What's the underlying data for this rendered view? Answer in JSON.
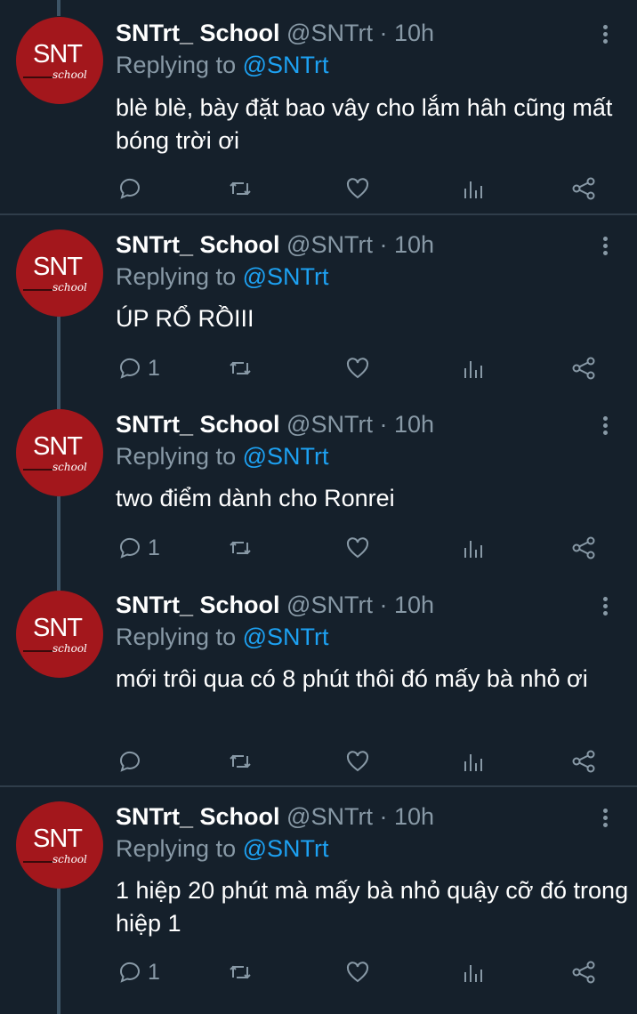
{
  "tweets": [
    {
      "name": "SNTrt_ School",
      "handle": "@SNTrt",
      "time": "· 10h",
      "replying": "Replying to",
      "mention": "@SNTrt",
      "text": "blè blè, bày đặt bao vây cho lắm hâh cũng mất bóng trời ơi",
      "reply_count": ""
    },
    {
      "name": "SNTrt_ School",
      "handle": "@SNTrt",
      "time": "· 10h",
      "replying": "Replying to",
      "mention": "@SNTrt",
      "text": "ÚP RỔ RỒIII",
      "reply_count": "1"
    },
    {
      "name": "SNTrt_ School",
      "handle": "@SNTrt",
      "time": "· 10h",
      "replying": "Replying to",
      "mention": "@SNTrt",
      "text": "two điểm dành cho Ronrei",
      "reply_count": "1"
    },
    {
      "name": "SNTrt_ School",
      "handle": "@SNTrt",
      "time": "· 10h",
      "replying": "Replying to",
      "mention": "@SNTrt",
      "text": "mới trôi qua có 8 phút thôi đó mấy bà nhỏ ơi",
      "reply_count": ""
    },
    {
      "name": "SNTrt_ School",
      "handle": "@SNTrt",
      "time": "· 10h",
      "replying": "Replying to",
      "mention": "@SNTrt",
      "text": "1 hiệp 20 phút mà mấy bà nhỏ quậy cỡ đó trong hiệp 1",
      "reply_count": "1"
    }
  ],
  "avatar": {
    "logo_text": "SNT",
    "logo_subtext": "school"
  },
  "icons": [
    "reply-icon",
    "retweet-icon",
    "like-icon",
    "analytics-icon",
    "share-icon",
    "more-icon"
  ],
  "colors": {
    "background": "#15202b",
    "secondary_text": "#8899a6",
    "mention": "#1da1f2",
    "avatar": "#a3171c"
  }
}
